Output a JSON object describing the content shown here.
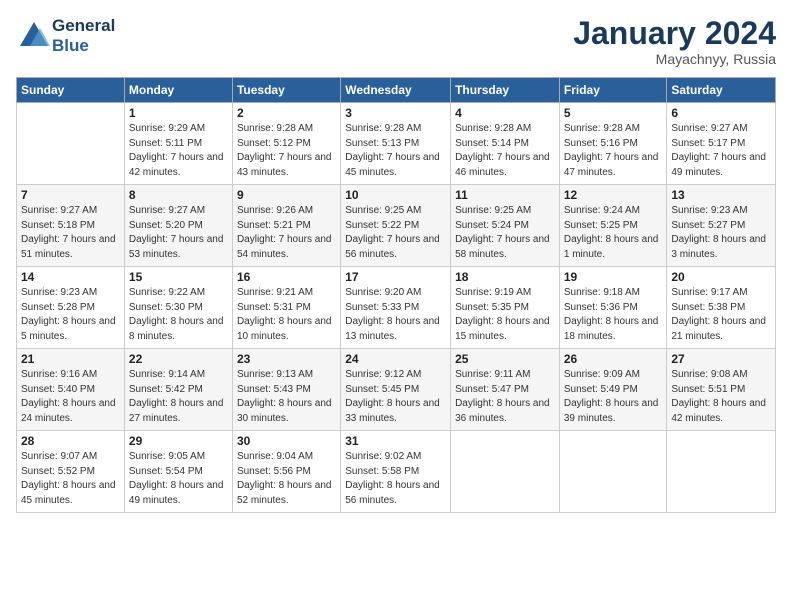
{
  "header": {
    "logo_line1": "General",
    "logo_line2": "Blue",
    "month": "January 2024",
    "location": "Mayachnyy, Russia"
  },
  "weekdays": [
    "Sunday",
    "Monday",
    "Tuesday",
    "Wednesday",
    "Thursday",
    "Friday",
    "Saturday"
  ],
  "weeks": [
    [
      {
        "day": "",
        "sunrise": "",
        "sunset": "",
        "daylight": ""
      },
      {
        "day": "1",
        "sunrise": "Sunrise: 9:29 AM",
        "sunset": "Sunset: 5:11 PM",
        "daylight": "Daylight: 7 hours and 42 minutes."
      },
      {
        "day": "2",
        "sunrise": "Sunrise: 9:28 AM",
        "sunset": "Sunset: 5:12 PM",
        "daylight": "Daylight: 7 hours and 43 minutes."
      },
      {
        "day": "3",
        "sunrise": "Sunrise: 9:28 AM",
        "sunset": "Sunset: 5:13 PM",
        "daylight": "Daylight: 7 hours and 45 minutes."
      },
      {
        "day": "4",
        "sunrise": "Sunrise: 9:28 AM",
        "sunset": "Sunset: 5:14 PM",
        "daylight": "Daylight: 7 hours and 46 minutes."
      },
      {
        "day": "5",
        "sunrise": "Sunrise: 9:28 AM",
        "sunset": "Sunset: 5:16 PM",
        "daylight": "Daylight: 7 hours and 47 minutes."
      },
      {
        "day": "6",
        "sunrise": "Sunrise: 9:27 AM",
        "sunset": "Sunset: 5:17 PM",
        "daylight": "Daylight: 7 hours and 49 minutes."
      }
    ],
    [
      {
        "day": "7",
        "sunrise": "Sunrise: 9:27 AM",
        "sunset": "Sunset: 5:18 PM",
        "daylight": "Daylight: 7 hours and 51 minutes."
      },
      {
        "day": "8",
        "sunrise": "Sunrise: 9:27 AM",
        "sunset": "Sunset: 5:20 PM",
        "daylight": "Daylight: 7 hours and 53 minutes."
      },
      {
        "day": "9",
        "sunrise": "Sunrise: 9:26 AM",
        "sunset": "Sunset: 5:21 PM",
        "daylight": "Daylight: 7 hours and 54 minutes."
      },
      {
        "day": "10",
        "sunrise": "Sunrise: 9:25 AM",
        "sunset": "Sunset: 5:22 PM",
        "daylight": "Daylight: 7 hours and 56 minutes."
      },
      {
        "day": "11",
        "sunrise": "Sunrise: 9:25 AM",
        "sunset": "Sunset: 5:24 PM",
        "daylight": "Daylight: 7 hours and 58 minutes."
      },
      {
        "day": "12",
        "sunrise": "Sunrise: 9:24 AM",
        "sunset": "Sunset: 5:25 PM",
        "daylight": "Daylight: 8 hours and 1 minute."
      },
      {
        "day": "13",
        "sunrise": "Sunrise: 9:23 AM",
        "sunset": "Sunset: 5:27 PM",
        "daylight": "Daylight: 8 hours and 3 minutes."
      }
    ],
    [
      {
        "day": "14",
        "sunrise": "Sunrise: 9:23 AM",
        "sunset": "Sunset: 5:28 PM",
        "daylight": "Daylight: 8 hours and 5 minutes."
      },
      {
        "day": "15",
        "sunrise": "Sunrise: 9:22 AM",
        "sunset": "Sunset: 5:30 PM",
        "daylight": "Daylight: 8 hours and 8 minutes."
      },
      {
        "day": "16",
        "sunrise": "Sunrise: 9:21 AM",
        "sunset": "Sunset: 5:31 PM",
        "daylight": "Daylight: 8 hours and 10 minutes."
      },
      {
        "day": "17",
        "sunrise": "Sunrise: 9:20 AM",
        "sunset": "Sunset: 5:33 PM",
        "daylight": "Daylight: 8 hours and 13 minutes."
      },
      {
        "day": "18",
        "sunrise": "Sunrise: 9:19 AM",
        "sunset": "Sunset: 5:35 PM",
        "daylight": "Daylight: 8 hours and 15 minutes."
      },
      {
        "day": "19",
        "sunrise": "Sunrise: 9:18 AM",
        "sunset": "Sunset: 5:36 PM",
        "daylight": "Daylight: 8 hours and 18 minutes."
      },
      {
        "day": "20",
        "sunrise": "Sunrise: 9:17 AM",
        "sunset": "Sunset: 5:38 PM",
        "daylight": "Daylight: 8 hours and 21 minutes."
      }
    ],
    [
      {
        "day": "21",
        "sunrise": "Sunrise: 9:16 AM",
        "sunset": "Sunset: 5:40 PM",
        "daylight": "Daylight: 8 hours and 24 minutes."
      },
      {
        "day": "22",
        "sunrise": "Sunrise: 9:14 AM",
        "sunset": "Sunset: 5:42 PM",
        "daylight": "Daylight: 8 hours and 27 minutes."
      },
      {
        "day": "23",
        "sunrise": "Sunrise: 9:13 AM",
        "sunset": "Sunset: 5:43 PM",
        "daylight": "Daylight: 8 hours and 30 minutes."
      },
      {
        "day": "24",
        "sunrise": "Sunrise: 9:12 AM",
        "sunset": "Sunset: 5:45 PM",
        "daylight": "Daylight: 8 hours and 33 minutes."
      },
      {
        "day": "25",
        "sunrise": "Sunrise: 9:11 AM",
        "sunset": "Sunset: 5:47 PM",
        "daylight": "Daylight: 8 hours and 36 minutes."
      },
      {
        "day": "26",
        "sunrise": "Sunrise: 9:09 AM",
        "sunset": "Sunset: 5:49 PM",
        "daylight": "Daylight: 8 hours and 39 minutes."
      },
      {
        "day": "27",
        "sunrise": "Sunrise: 9:08 AM",
        "sunset": "Sunset: 5:51 PM",
        "daylight": "Daylight: 8 hours and 42 minutes."
      }
    ],
    [
      {
        "day": "28",
        "sunrise": "Sunrise: 9:07 AM",
        "sunset": "Sunset: 5:52 PM",
        "daylight": "Daylight: 8 hours and 45 minutes."
      },
      {
        "day": "29",
        "sunrise": "Sunrise: 9:05 AM",
        "sunset": "Sunset: 5:54 PM",
        "daylight": "Daylight: 8 hours and 49 minutes."
      },
      {
        "day": "30",
        "sunrise": "Sunrise: 9:04 AM",
        "sunset": "Sunset: 5:56 PM",
        "daylight": "Daylight: 8 hours and 52 minutes."
      },
      {
        "day": "31",
        "sunrise": "Sunrise: 9:02 AM",
        "sunset": "Sunset: 5:58 PM",
        "daylight": "Daylight: 8 hours and 56 minutes."
      },
      {
        "day": "",
        "sunrise": "",
        "sunset": "",
        "daylight": ""
      },
      {
        "day": "",
        "sunrise": "",
        "sunset": "",
        "daylight": ""
      },
      {
        "day": "",
        "sunrise": "",
        "sunset": "",
        "daylight": ""
      }
    ]
  ]
}
